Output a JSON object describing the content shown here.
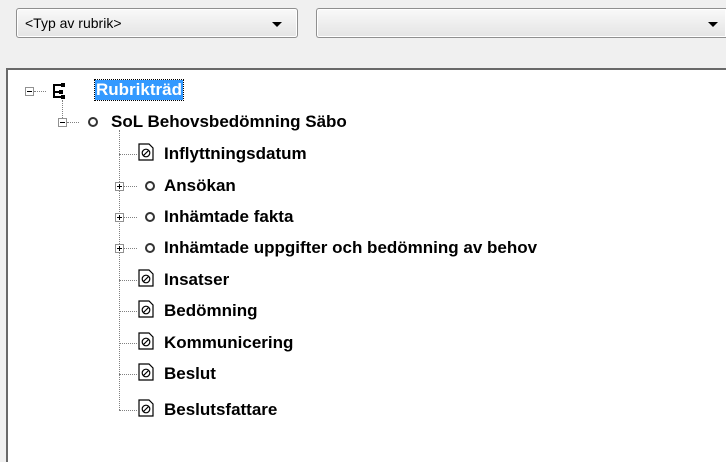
{
  "toolbar": {
    "heading_type_combo": {
      "value": "<Typ av rubrik>"
    },
    "second_combo": {
      "value": ""
    }
  },
  "tree": {
    "root": {
      "label": "Rubrikträd",
      "expanded": true,
      "selected": true,
      "icon": "tree-structure-icon"
    },
    "template": {
      "label": "SoL Behovsbedömning Säbo",
      "expanded": true,
      "icon": "bullet-icon"
    },
    "children": [
      {
        "label": "Inflyttningsdatum",
        "icon": "document-icon",
        "expandable": false
      },
      {
        "label": "Ansökan",
        "icon": "bullet-icon",
        "expandable": true
      },
      {
        "label": "Inhämtade fakta",
        "icon": "bullet-icon",
        "expandable": true
      },
      {
        "label": "Inhämtade uppgifter och bedömning av behov",
        "icon": "bullet-icon",
        "expandable": true
      },
      {
        "label": "Insatser",
        "icon": "document-icon",
        "expandable": false
      },
      {
        "label": "Bedömning",
        "icon": "document-icon",
        "expandable": false
      },
      {
        "label": "Kommunicering",
        "icon": "document-icon",
        "expandable": false
      },
      {
        "label": "Beslut",
        "icon": "document-icon",
        "expandable": false
      },
      {
        "label": "Beslutsfattare",
        "icon": "document-icon",
        "expandable": false
      }
    ]
  },
  "colors": {
    "selection": "#3399ff",
    "background": "#f0f0f0",
    "tree_background": "#ffffff"
  }
}
